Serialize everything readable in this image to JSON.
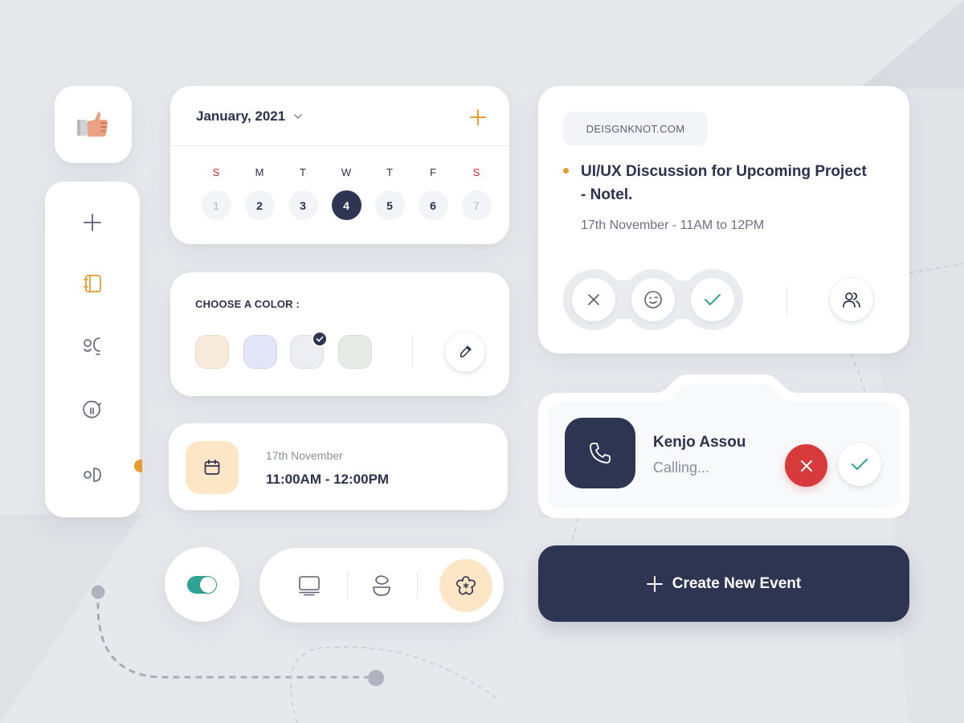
{
  "theme": {
    "accent": "#e69c2f",
    "navy": "#2e3553",
    "teal": "#2fa394",
    "danger": "#d63a3a",
    "weekend": "#d62828"
  },
  "thumb_card": {
    "icon": "thumbs-up-emoji"
  },
  "sidebar": {
    "items": [
      {
        "name": "add",
        "icon": "plus-icon",
        "active": false
      },
      {
        "name": "notebook",
        "icon": "notebook-icon",
        "active": true
      },
      {
        "name": "contacts",
        "icon": "contacts-icon",
        "active": false
      },
      {
        "name": "chat",
        "icon": "chat-bubble-icon",
        "active": false
      },
      {
        "name": "toggle",
        "icon": "toggle-shape-icon",
        "active": false
      }
    ]
  },
  "calendar": {
    "title": "January, 2021",
    "days": [
      {
        "dow": "S",
        "date": "1",
        "weekend": true,
        "state": "muted"
      },
      {
        "dow": "M",
        "date": "2",
        "weekend": false,
        "state": "normal"
      },
      {
        "dow": "T",
        "date": "3",
        "weekend": false,
        "state": "normal"
      },
      {
        "dow": "W",
        "date": "4",
        "weekend": false,
        "state": "active"
      },
      {
        "dow": "T",
        "date": "5",
        "weekend": false,
        "state": "normal"
      },
      {
        "dow": "F",
        "date": "6",
        "weekend": false,
        "state": "normal"
      },
      {
        "dow": "S",
        "date": "7",
        "weekend": true,
        "state": "muted"
      }
    ]
  },
  "color_chooser": {
    "label": "CHOOSE A COLOR :",
    "swatches": [
      {
        "color": "#f8eadb",
        "border": "#ecd9bf",
        "selected": false
      },
      {
        "color": "#e3e6f8",
        "border": "#cdd2ee",
        "selected": false
      },
      {
        "color": "#eceef3",
        "border": "#dcdfe6",
        "selected": true
      },
      {
        "color": "#e6ebe7",
        "border": "#d5dcd7",
        "selected": false
      }
    ]
  },
  "event_time": {
    "date": "17th November",
    "time": "11:00AM - 12:00PM"
  },
  "toggle": {
    "on": true
  },
  "segment": {
    "items": [
      {
        "icon": "monitor-icon",
        "active": false
      },
      {
        "icon": "user-abstract-icon",
        "active": false
      },
      {
        "icon": "flower-icon",
        "active": true
      }
    ]
  },
  "event_card": {
    "domain": "DEISGNKNOT.COM",
    "title": "UI/UX Discussion for Upcoming Project - Notel.",
    "subtitle": "17th November - 11AM to 12PM",
    "reactions": [
      "close-icon",
      "wink-face-icon",
      "check-icon"
    ]
  },
  "call": {
    "name": "Kenjo Assou",
    "status": "Calling..."
  },
  "create_button": {
    "label": "Create New Event"
  }
}
